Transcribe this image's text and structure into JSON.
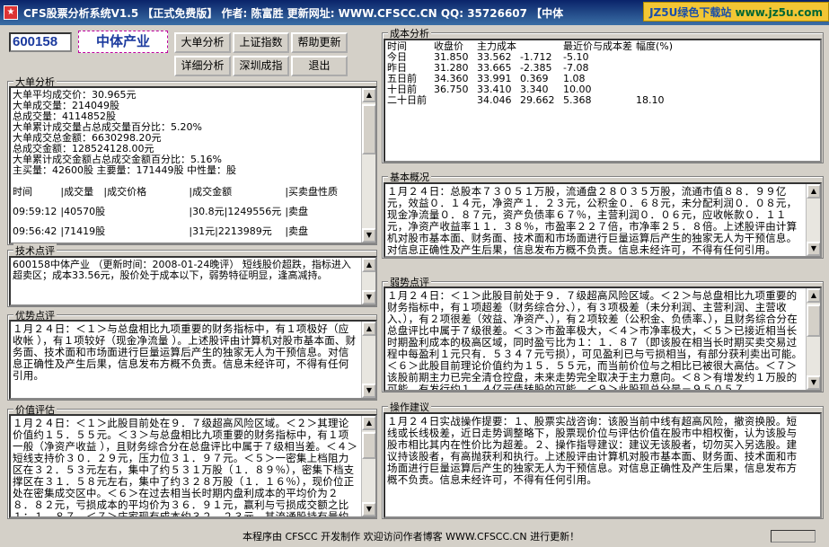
{
  "window": {
    "title": "CFS股票分析系统V1.5 【正式免费版】 作者: 陈富胜 更新网址: WWW.CFSCC.CN QQ: 35726607 【中体",
    "badge_text": "JZ5U绿色下载站",
    "badge_url": "www.jz5u.com"
  },
  "stock": {
    "code": "600158",
    "name": "中体产业"
  },
  "buttons": {
    "big_order": "大单分析",
    "sh_index": "上证指数",
    "help_update": "帮助更新",
    "detail": "详细分析",
    "sz_index": "深圳成指",
    "exit": "退出"
  },
  "big_order": {
    "title": "大单分析",
    "lines": [
      "大单平均成交价：30.965元",
      "大单成交量：214049股",
      "总成交量：4114852股",
      "大单累计成交量占总成交量百分比：5.20%",
      "大单成交总金额：6630298.20元",
      "总成交金额：128524128.00元",
      "大单累计成交金额占总成交金额百分比：5.16%",
      "主买量：42600股 主要量：171449股 中性量：股"
    ],
    "headers": [
      "时间",
      "|成交量",
      "|成交价格",
      "|成交金额",
      "|买卖盘性质"
    ],
    "rows": [
      [
        "09:59:12",
        "|40570股",
        "|30.8元",
        "|1249556元",
        "|卖盘"
      ],
      [
        "09:56:42",
        "|71419股",
        "|31元",
        "|2213989元",
        "|卖盘"
      ]
    ]
  },
  "tech": {
    "title": "技术点评",
    "text": "600158中体产业 （更新时间：2008-01-24晚评） 短线股价超跌，指标进入超卖区；成本33.56元，股价处于成本以下，弱势特征明显，逢高减持。"
  },
  "strength": {
    "title": "优势点评",
    "text": "１月２４日：＜１＞与总盘相比九项重要的财务指标中，有１项极好（应收帐 ），有１项较好（现金净流量 ）。上述股评由计算机对股市基本面、财务面、技术面和市场面进行巨量运算后产生的独家无人为干预信息。对信息正确性及产生后果，信息发布方概不负责。信息未经许可，不得有任何引用。"
  },
  "value": {
    "title": "价值评估",
    "text": "１月２４日：＜１＞此股目前处在９．７级超高风险区域。＜２＞其理论价值约１５．５５元。＜３＞与总盘相比九项重要的财务指标中，有１项一般（净资产收益 ），且财务综合分在总盘评比中属于７级相当差。＜４＞短线支持价３０．２９元，压力位３１．９７元。＜５＞一密集上档阻力区在３２．５３元左右，集中了约５３１万股（１．８９％），密集下档支撑区在３１．５８元左右，集中了约３２８万股（１．１６％），现价位正处在密集成交区中。＜６＞在过去相当长时期内盘利成本的平均价为２８．８２元，亏损成本的平均价为３６．９１元，赢利与亏损成交额之比１：１．８７。＜７＞庄家现有成本约３２．２３元，其流通股持有量约５"
  },
  "cost": {
    "title": "成本分析",
    "headers": [
      "时间",
      "收盘价",
      "主力成本",
      "",
      "最近价与成本差",
      "幅度(%)"
    ],
    "rows": [
      [
        "今日",
        "31.850",
        "33.562",
        "-1.712",
        "-5.10",
        ""
      ],
      [
        "昨日",
        "31.280",
        "33.665",
        "-2.385",
        "-7.08",
        ""
      ],
      [
        "五日前",
        "34.360",
        "33.991",
        "0.369",
        "1.08",
        ""
      ],
      [
        "十日前",
        "36.750",
        "33.410",
        "3.340",
        "10.00",
        ""
      ],
      [
        "二十日前",
        "",
        "34.046",
        "29.662",
        "5.368",
        "18.10"
      ]
    ]
  },
  "basic": {
    "title": "基本概况",
    "text": "１月２４日：总股本７３０５１万股，流通盘２８０３５万股，流通市值８８．９９亿元，效益０．１４元，净资产１．２３元，公积金０．６８元，未分配利润０．０８元，现金净流量０．８７元，资产负债率６７％，主营利润０．０６元，应收帐款０．１１元，净资产收益率１１．３８％，市盈率２２７倍，市净率２５．８倍。上述股评由计算机对股市基本面、财务面、技术面和市场面进行巨量运算后产生的独家无人为干预信息。对信息正确性及产生后果，信息发布方概不负责。信息未经许可，不得有任何引用。"
  },
  "weakness": {
    "title": "弱势点评",
    "text": "１月２４日：＜１＞此股目前处于９．７级超高风险区域。＜２＞与总盘相比九项重要的财务指标中，有１项超差（财务综合分、），有３项极差（未分利润、主营利润、主营收入、），有２项很差（效益、净资产、），有２项较差（公积金、负债率、），且财务综合分在总盘评比中属于７级很差。＜３＞市盈率极大，＜４＞市净率极大，＜５＞已接近相当长时期盈利成本的极高区域，同时盈亏比为１：１．８７（即该股在相当长时期买卖交易过程中每盈利１元只有．５３４７元亏损），可见盈利已与亏损相当，有部分获利卖出可能。＜６＞此股目前理论价值约为１５．５５元，而当前价位与之相比已被很大高估。＜７＞该股前期主力已完全清仓控盘，未来走势完全取决于主力意向。＜８＞有增发约１万股的可能，有发行约１．４亿元债转股的可能。＜９＞此股现总分是－９５０５７"
  },
  "advice": {
    "title": "操作建议",
    "text": "１月２４日实战操作提要：１、股票实战咨询：该股当前中线有超高风险，撤资换股。短线或长线极差，近日走势调整略下，股票现价位与评估价值在股市中相权衡，认为该股与股市相比其内在性价比为超差。２、操作指导建议：建议无该股者，切勿买入另选股。建议持该股者，有高抛获利和执行。上述股评由计算机对股市基本面、财务面、技术面和市场面进行巨量运算后产生的独家无人为干预信息。对信息正确性及产生后果，信息发布方概不负责。信息未经许可，不得有任何引用。"
  },
  "status": {
    "message": "本程序由 CFSCC 开发制作 欢迎访问作者博客 WWW.CFSCC.CN 进行更新！"
  }
}
